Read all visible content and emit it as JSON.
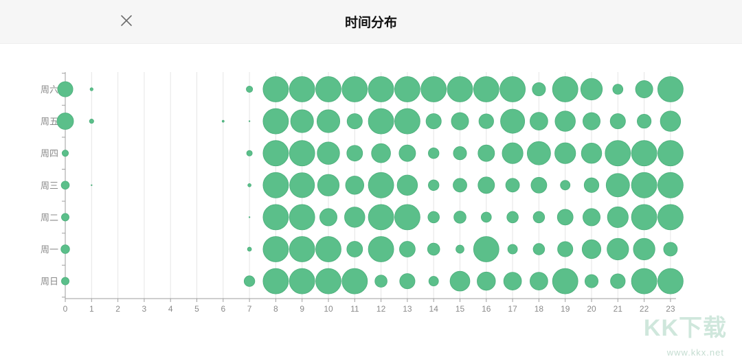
{
  "header": {
    "title": "时间分布"
  },
  "watermark": {
    "text": "KK下载",
    "url": "www.kkx.net"
  },
  "colors": {
    "bubble": "#5bbf8a",
    "bubble_stroke": "#4cae7b",
    "grid": "#e5e5e5",
    "axis": "#9e9e9e",
    "label": "#8a8a8a"
  },
  "chart_data": {
    "type": "bubble",
    "title": "时间分布",
    "x": [
      "0",
      "1",
      "2",
      "3",
      "4",
      "5",
      "6",
      "7",
      "8",
      "9",
      "10",
      "11",
      "12",
      "13",
      "14",
      "15",
      "16",
      "17",
      "18",
      "19",
      "20",
      "21",
      "22",
      "23"
    ],
    "y": [
      "周六",
      "周五",
      "周四",
      "周三",
      "周二",
      "周一",
      "周日"
    ],
    "grid": true,
    "size_scale": "relative radius 0-10",
    "values": [
      [
        6.0,
        1.2,
        0,
        0,
        0,
        0,
        0,
        2.5,
        10,
        10,
        10,
        10,
        10,
        10,
        10,
        10,
        10,
        10,
        5.2,
        10,
        8.5,
        4.0,
        6.8,
        10
      ],
      [
        6.5,
        1.7,
        0,
        0,
        0,
        0,
        0.8,
        0.3,
        10,
        9.0,
        9.0,
        6.0,
        10,
        10,
        6.0,
        6.8,
        5.8,
        9.5,
        7.0,
        8.0,
        6.8,
        6.0,
        5.5,
        8.0
      ],
      [
        2.5,
        0,
        0,
        0,
        0,
        0,
        0,
        2.2,
        10,
        10,
        8.8,
        6.2,
        7.5,
        6.5,
        4.2,
        5.2,
        6.5,
        8.2,
        9.2,
        8.2,
        8.0,
        10,
        10,
        10
      ],
      [
        3.2,
        0.3,
        0,
        0,
        0,
        0,
        0,
        1.3,
        10,
        9.8,
        8.5,
        7.2,
        10,
        8.0,
        4.2,
        5.4,
        6.5,
        5.4,
        6.2,
        3.8,
        5.8,
        9.2,
        10,
        10
      ],
      [
        3.0,
        0,
        0,
        0,
        0,
        0,
        0,
        0.3,
        10,
        10,
        6.8,
        8.0,
        10,
        10,
        4.5,
        4.8,
        4.0,
        4.5,
        4.5,
        6.2,
        6.8,
        8.2,
        10,
        10
      ],
      [
        3.4,
        0,
        0,
        0,
        0,
        0,
        0,
        1.6,
        10,
        10,
        10,
        6.2,
        10,
        6.2,
        4.8,
        3.2,
        10,
        3.8,
        4.5,
        6.0,
        7.4,
        8.5,
        8.5,
        5.4
      ],
      [
        3.0,
        0,
        0,
        0,
        0,
        0,
        0,
        4.2,
        10,
        10,
        10,
        10,
        4.8,
        6.0,
        3.8,
        7.8,
        7.2,
        7.0,
        7.0,
        10,
        5.2,
        5.8,
        10,
        10
      ]
    ]
  }
}
